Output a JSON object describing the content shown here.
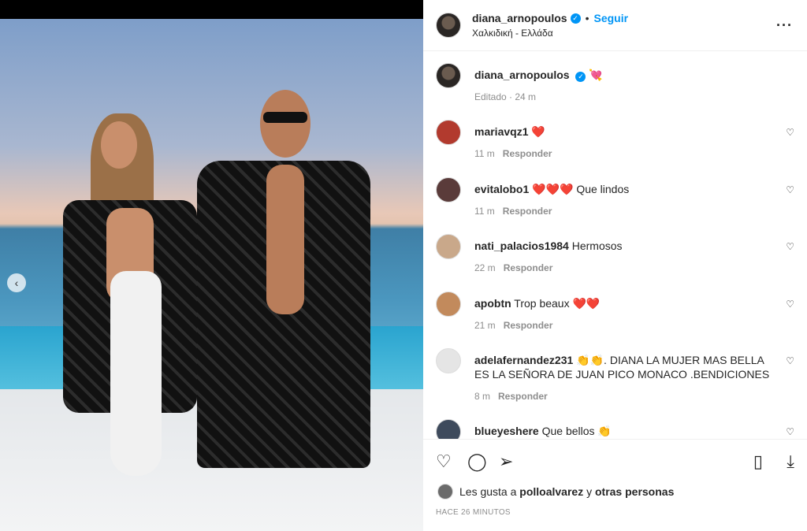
{
  "post": {
    "username": "diana_arnopoulos",
    "follow_label": "Seguir",
    "location": "Χαλκιδική - Ελλάδα",
    "caption_emoji": "💘",
    "edited_label": "Editado · 24 m"
  },
  "comments": [
    {
      "user": "mariavqz1",
      "text": "❤️",
      "time": "11 m",
      "reply": "Responder",
      "avatar_color": "#b23a2e"
    },
    {
      "user": "evitalobo1",
      "text": "❤️❤️❤️ Que lindos",
      "time": "11 m",
      "reply": "Responder",
      "avatar_color": "#5a3b3a"
    },
    {
      "user": "nati_palacios1984",
      "text": "Hermosos",
      "time": "22 m",
      "reply": "Responder",
      "avatar_color": "#c9a88a"
    },
    {
      "user": "apobtn",
      "text": "Trop beaux ❤️❤️",
      "time": "21 m",
      "reply": "Responder",
      "avatar_color": "#c28a5c"
    },
    {
      "user": "adelafernandez231",
      "text": "👏👏. DIANA LA MUJER MAS BELLA ES LA SEÑORA DE JUAN PICO MONACO .BENDICIONES",
      "time": "8 m",
      "reply": "Responder",
      "avatar_color": "#e5e5e5"
    },
    {
      "user": "blueyeshere",
      "text": "Que bellos 👏",
      "time": "",
      "reply": "",
      "avatar_color": "#3e4a5c"
    }
  ],
  "likes": {
    "prefix": "Les gusta a",
    "user": "polloalvarez",
    "conj": "y",
    "others": "otras personas"
  },
  "time_ago": "HACE 26 MINUTOS",
  "icons": {
    "like": "heart-icon",
    "comment": "comment-icon",
    "share": "share-icon",
    "save": "bookmark-icon",
    "download": "download-icon",
    "more": "more-icon",
    "prev": "chevron-left-icon"
  }
}
